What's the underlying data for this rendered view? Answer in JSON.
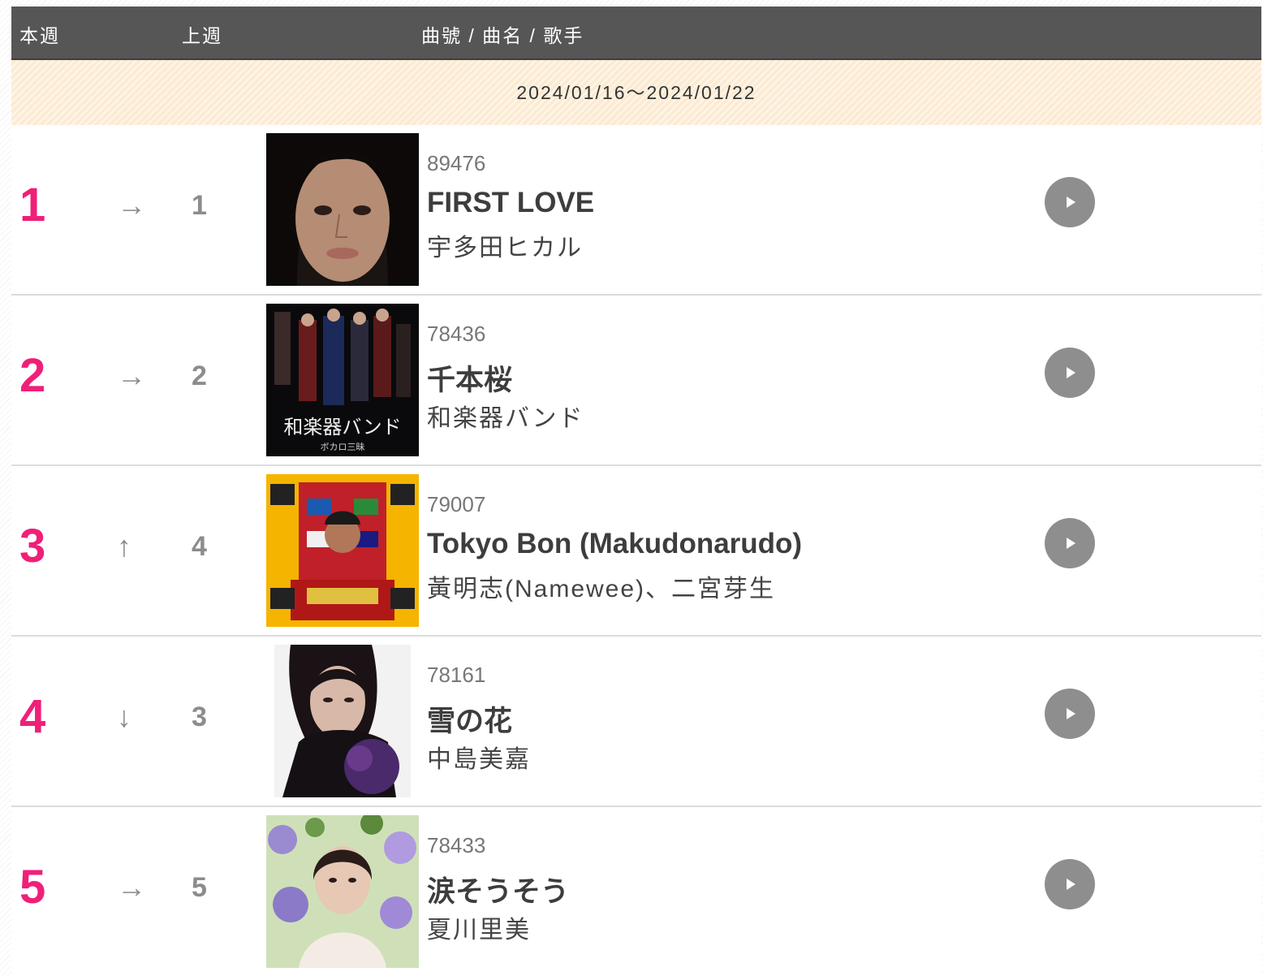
{
  "header": {
    "this_week": "本週",
    "last_week": "上週",
    "song_info": "曲號 / 曲名 / 歌手"
  },
  "date_range": "2024/01/16～2024/01/22",
  "rows": [
    {
      "rank": "1",
      "trend": "→",
      "last": "1",
      "number": "89476",
      "title": "FIRST LOVE",
      "artist": "宇多田ヒカル"
    },
    {
      "rank": "2",
      "trend": "→",
      "last": "2",
      "number": "78436",
      "title": "千本桜",
      "artist": "和楽器バンド",
      "cover_text": "和楽器バンド",
      "cover_subtext": "ボカロ三昧"
    },
    {
      "rank": "3",
      "trend": "↑",
      "last": "4",
      "number": "79007",
      "title": "Tokyo Bon (Makudonarudo)",
      "artist": "黃明志(Namewee)、二宮芽生"
    },
    {
      "rank": "4",
      "trend": "↓",
      "last": "3",
      "number": "78161",
      "title": "雪の花",
      "artist": "中島美嘉"
    },
    {
      "rank": "5",
      "trend": "→",
      "last": "5",
      "number": "78433",
      "title": "涙そうそう",
      "artist": "夏川里美"
    }
  ],
  "icons": {
    "trend_same": "arrow-right-icon",
    "trend_up": "arrow-up-icon",
    "trend_down": "arrow-down-icon",
    "play": "play-icon"
  },
  "colors": {
    "rank": "#f01f78",
    "header_bg": "#565656",
    "date_bg": "#fcebd3",
    "play_button": "#8e8e8e"
  }
}
